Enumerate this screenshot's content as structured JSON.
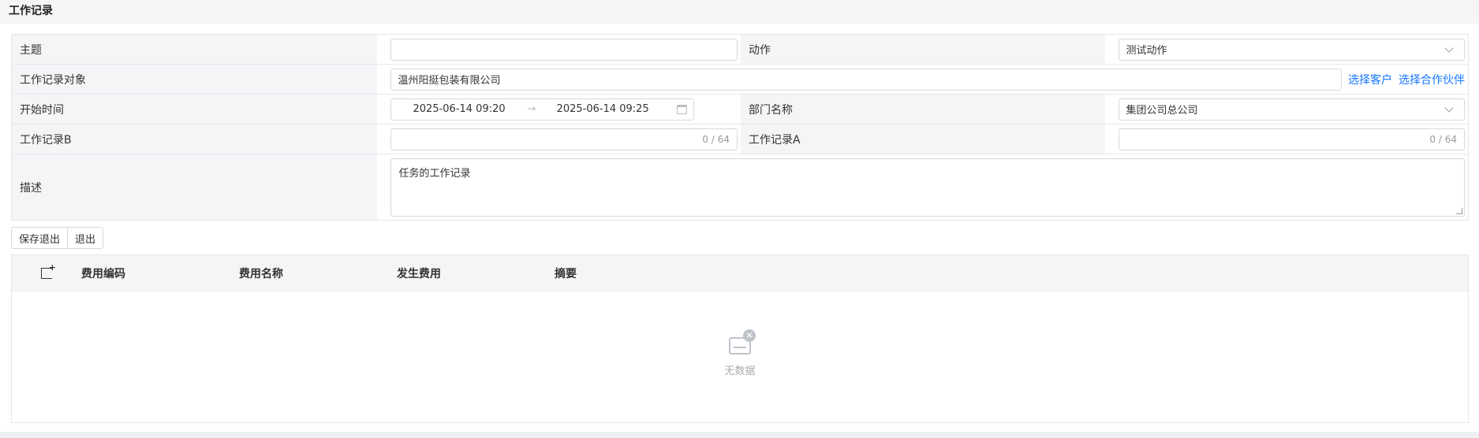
{
  "page": {
    "title": "工作记录"
  },
  "form": {
    "subject_label": "主题",
    "subject_value": "",
    "action_label": "动作",
    "action_value": "测试动作",
    "target_label": "工作记录对象",
    "target_value": "温州阳挺包装有限公司",
    "select_customer_link": "选择客户",
    "select_partner_link": "选择合作伙伴",
    "start_time_label": "开始时间",
    "start_time_from": "2025-06-14 09:20",
    "start_time_arrow": "→",
    "start_time_to": "2025-06-14 09:25",
    "dept_label": "部门名称",
    "dept_value": "集团公司总公司",
    "record_b_label": "工作记录B",
    "record_b_counter": "0 / 64",
    "record_a_label": "工作记录A",
    "record_a_counter": "0 / 64",
    "desc_label": "描述",
    "desc_value": "任务的工作记录"
  },
  "buttons": {
    "save_exit": "保存退出",
    "exit": "退出"
  },
  "grid": {
    "columns": [
      "费用编码",
      "费用名称",
      "发生费用",
      "摘要"
    ],
    "empty_text": "无数据"
  }
}
